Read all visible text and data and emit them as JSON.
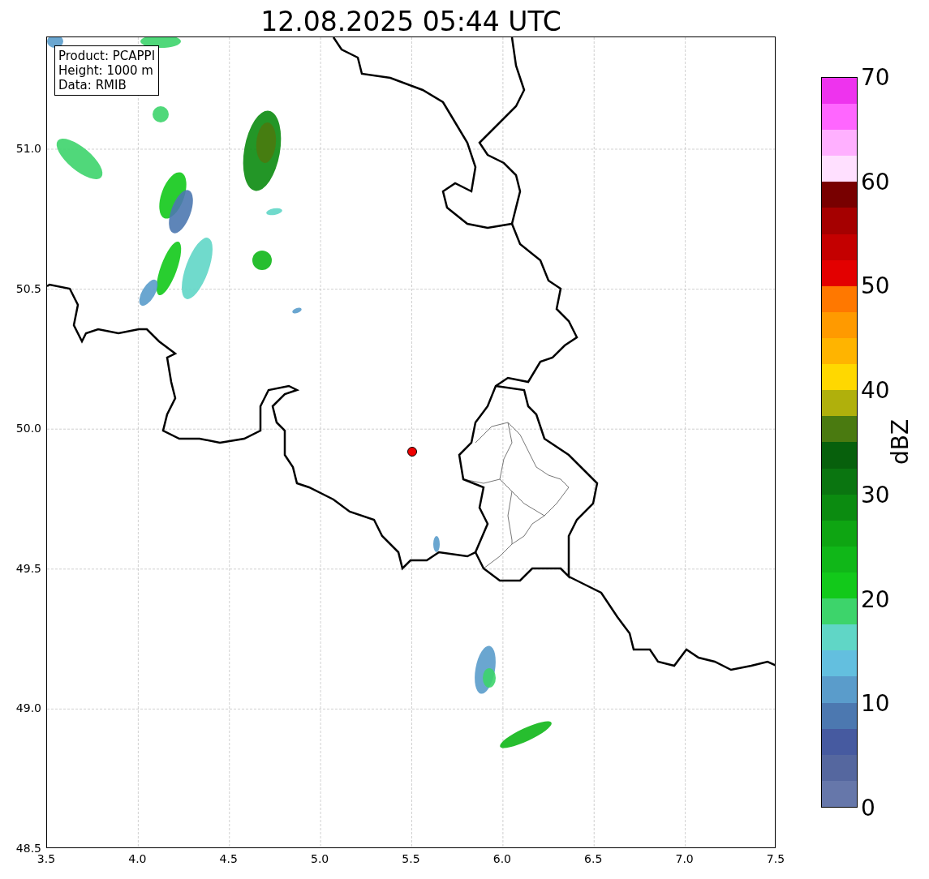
{
  "title": "12.08.2025 05:44 UTC",
  "info_box": [
    "Product: PCAPPI",
    "Height: 1000 m",
    "Data: RMIB"
  ],
  "map": {
    "xticks": [
      "3.5",
      "4.0",
      "4.5",
      "5.0",
      "5.5",
      "6.0",
      "6.5",
      "7.0",
      "7.5"
    ],
    "yticks": [
      "51.0",
      "50.5",
      "50.0",
      "49.5",
      "49.0",
      "48.5"
    ]
  },
  "colorbar": {
    "label": "dBZ",
    "ticks": [
      "70",
      "60",
      "50",
      "40",
      "30",
      "20",
      "10",
      "0"
    ],
    "segments": [
      {
        "color": "#6677aa"
      },
      {
        "color": "#55679f"
      },
      {
        "color": "#465aa0"
      },
      {
        "color": "#4c78b0"
      },
      {
        "color": "#5a9ccb"
      },
      {
        "color": "#63bfdf"
      },
      {
        "color": "#60d6c6"
      },
      {
        "color": "#3dd46b"
      },
      {
        "color": "#12c91a"
      },
      {
        "color": "#10b718"
      },
      {
        "color": "#0ea512"
      },
      {
        "color": "#0b8b10"
      },
      {
        "color": "#0a7510"
      },
      {
        "color": "#07600c"
      },
      {
        "color": "#4a7a10"
      },
      {
        "color": "#b0b00c"
      },
      {
        "color": "#ffd800"
      },
      {
        "color": "#ffb400"
      },
      {
        "color": "#ff9a00"
      },
      {
        "color": "#ff7800"
      },
      {
        "color": "#e30000"
      },
      {
        "color": "#c40000"
      },
      {
        "color": "#a50000"
      },
      {
        "color": "#780000"
      },
      {
        "color": "#ffe0ff"
      },
      {
        "color": "#ffb0ff"
      },
      {
        "color": "#ff66ff"
      },
      {
        "color": "#ee33ee"
      }
    ]
  }
}
